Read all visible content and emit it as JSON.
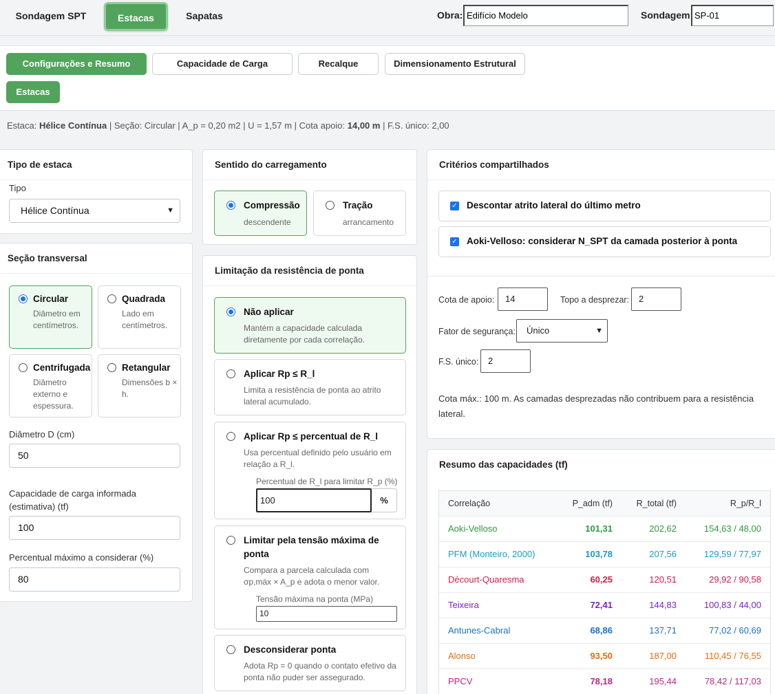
{
  "top": {
    "tabs": [
      "Sondagem SPT",
      "Estacas",
      "Sapatas"
    ],
    "obra_label": "Obra:",
    "obra_value": "Edifício Modelo",
    "sondagem_label": "Sondagem:",
    "sondagem_value": "SP-01"
  },
  "subtabs": [
    "Configurações e Resumo",
    "Capacidade de Carga",
    "Recalque",
    "Dimensionamento Estrutural",
    "Estacas"
  ],
  "info": {
    "p1": "Estaca: ",
    "tipo": "Hélice Contínua",
    "p2": " | Seção: Circular | A_p = 0,20 m2 | U = 1,57 m | Cota apoio: ",
    "cota": "14,00 m",
    "p3": " | F.S. único: 2,00"
  },
  "tipo_estaca": {
    "title": "Tipo de estaca",
    "label": "Tipo",
    "value": "Hélice Contínua"
  },
  "secao": {
    "title": "Seção transversal",
    "options": [
      {
        "title": "Circular",
        "desc": "Diâmetro em centímetros."
      },
      {
        "title": "Quadrada",
        "desc": "Lado em centímetros."
      },
      {
        "title": "Centrifugada",
        "desc": "Diâmetro externo e espessura."
      },
      {
        "title": "Retangular",
        "desc": "Dimensões b × h."
      }
    ],
    "diametro_label": "Diâmetro D (cm)",
    "diametro_value": "50",
    "cap_label": "Capacidade de carga informada (estimativa) (tf)",
    "cap_value": "100",
    "perc_label": "Percentual máximo a considerar (%)",
    "perc_value": "80"
  },
  "sentido": {
    "title": "Sentido do carregamento",
    "options": [
      {
        "title": "Compressão",
        "desc": "descendente"
      },
      {
        "title": "Tração",
        "desc": "arrancamento"
      }
    ]
  },
  "limitacao": {
    "title": "Limitação da resistência de ponta",
    "options": [
      {
        "title": "Não aplicar",
        "desc": "Mantém a capacidade calculada diretamente por cada correlação."
      },
      {
        "title": "Aplicar Rp ≤ R_l",
        "desc": "Limita a resistência de ponta ao atrito lateral acumulado."
      },
      {
        "title": "Aplicar Rp ≤ percentual de R_l",
        "desc": "Usa percentual definido pelo usuário em relação a R_l."
      },
      {
        "title": "Limitar pela tensão máxima de ponta",
        "desc": "Compara a parcela calculada com σp,máx × A_p e adota o menor valor."
      },
      {
        "title": "Desconsiderar ponta",
        "desc": "Adota Rp = 0 quando o contato efetivo da ponta não puder ser assegurado."
      }
    ],
    "perc_label": "Percentual de R_l para limitar R_p (%)",
    "perc_value": "100",
    "perc_unit": "%",
    "tensao_label": "Tensão máxima na ponta (MPa)",
    "tensao_value": "10"
  },
  "criterios": {
    "title": "Critérios compartilhados",
    "check1": "Descontar atrito lateral do último metro",
    "check2": "Aoki-Velloso: considerar N_SPT da camada posterior à ponta",
    "cota_apoio_label": "Cota de apoio:",
    "cota_apoio_value": "14",
    "topo_label": "Topo a desprezar:",
    "topo_value": "2",
    "fator_label": "Fator de segurança:",
    "fator_value": "Único",
    "fs_label": "F.S. único:",
    "fs_value": "2",
    "note": "Cota máx.: 100 m. As camadas desprezadas não contribuem para a resistência lateral."
  },
  "resumo": {
    "title": "Resumo das capacidades (tf)",
    "headers": [
      "Correlação",
      "P_adm (tf)",
      "R_total (tf)",
      "R_p/R_l"
    ],
    "rows": [
      {
        "name": "Aoki-Velloso",
        "padm": "101,31",
        "rtotal": "202,62",
        "rprl": "154,63 / 48,00",
        "color": "#2e9a3c"
      },
      {
        "name": "PFM (Monteiro, 2000)",
        "padm": "103,78",
        "rtotal": "207,56",
        "rprl": "129,59 / 77,97",
        "color": "#1a9bc7"
      },
      {
        "name": "Décourt-Quaresma",
        "padm": "60,25",
        "rtotal": "120,51",
        "rprl": "29,92 / 90,58",
        "color": "#d81b4a"
      },
      {
        "name": "Teixeira",
        "padm": "72,41",
        "rtotal": "144,83",
        "rprl": "100,83 / 44,00",
        "color": "#7e22ce"
      },
      {
        "name": "Antunes-Cabral",
        "padm": "68,86",
        "rtotal": "137,71",
        "rprl": "77,02 / 60,69",
        "color": "#1d6fc4"
      },
      {
        "name": "Alonso",
        "padm": "93,50",
        "rtotal": "187,00",
        "rprl": "110,45 / 76,55",
        "color": "#ea6a10"
      },
      {
        "name": "PPCV",
        "padm": "78,18",
        "rtotal": "195,44",
        "rprl": "78,42 / 117,03",
        "color": "#c0267f"
      }
    ]
  }
}
